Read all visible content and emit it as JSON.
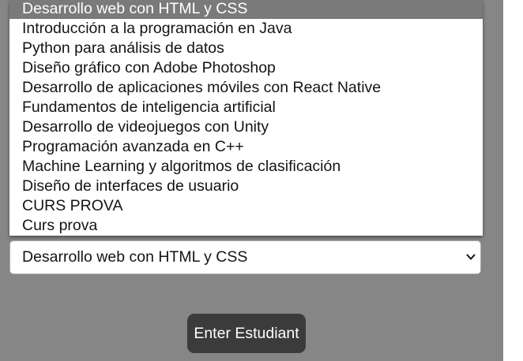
{
  "dropdown": {
    "options": [
      "Desarrollo web con HTML y CSS",
      "Introducción a la programación en Java",
      "Python para análisis de datos",
      "Diseño gráfico con Adobe Photoshop",
      "Desarrollo de aplicaciones móviles con React Native",
      "Fundamentos de inteligencia artificial",
      "Desarrollo de videojuegos con Unity",
      "Programación avanzada en C++",
      "Machine Learning y algoritmos de clasificación",
      "Diseño de interfaces de usuario",
      "CURS PROVA",
      "Curs prova"
    ],
    "highlighted_index": 0
  },
  "select": {
    "value": "Desarrollo web con HTML y CSS",
    "icon": "chevron-down-icon"
  },
  "button": {
    "label": "Enter Estudiant"
  },
  "colors": {
    "page_background": "#868686",
    "highlight": "#7a7a7a",
    "button_background": "#3b3b3b"
  }
}
